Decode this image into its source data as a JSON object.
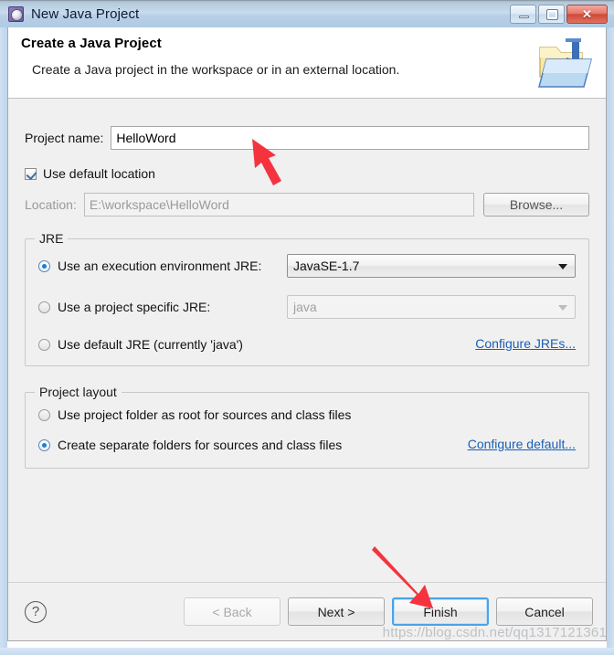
{
  "window": {
    "title": "New Java Project",
    "icon": "eclipse-wizard-icon",
    "buttons": {
      "minimize": "minimize-button",
      "maximize": "maximize-button",
      "close_glyph": "✕"
    }
  },
  "header": {
    "title": "Create a Java Project",
    "description": "Create a Java project in the workspace or in an external location.",
    "icon": "java-project-folder-icon"
  },
  "form": {
    "project_name_label": "Project name:",
    "project_name_value": "HelloWord",
    "use_default_location_label": "Use default location",
    "use_default_location_checked": true,
    "location_label": "Location:",
    "location_value": "E:\\workspace\\HelloWord",
    "browse_label": "Browse..."
  },
  "jre_group": {
    "title": "JRE",
    "options": [
      {
        "label": "Use an execution environment JRE:",
        "selected": true,
        "combo_value": "JavaSE-1.7",
        "combo_enabled": true
      },
      {
        "label": "Use a project specific JRE:",
        "selected": false,
        "combo_value": "java",
        "combo_enabled": false
      },
      {
        "label": "Use default JRE (currently 'java')",
        "selected": false
      }
    ],
    "configure_link": "Configure JREs..."
  },
  "layout_group": {
    "title": "Project layout",
    "options": [
      {
        "label": "Use project folder as root for sources and class files",
        "selected": false
      },
      {
        "label": "Create separate folders for sources and class files",
        "selected": true
      }
    ],
    "configure_link": "Configure default..."
  },
  "footer": {
    "help_glyph": "?",
    "buttons": [
      {
        "label": "< Back",
        "state": "disabled"
      },
      {
        "label": "Next >",
        "state": "enabled"
      },
      {
        "label": "Finish",
        "state": "focused"
      },
      {
        "label": "Cancel",
        "state": "enabled"
      }
    ]
  },
  "watermark": "https://blog.csdn.net/qq1317121361",
  "annotations": {
    "arrow_color": "#f5333f",
    "arrow_1": "points-up-left-at-project-name-field",
    "arrow_2": "points-down-right-at-finish-button"
  },
  "colors": {
    "accent_link": "#1a5fb4",
    "focus_ring": "#4aa3e8",
    "radio_dot": "#1b7fd4",
    "dialog_bg": "#f0f0f0"
  }
}
